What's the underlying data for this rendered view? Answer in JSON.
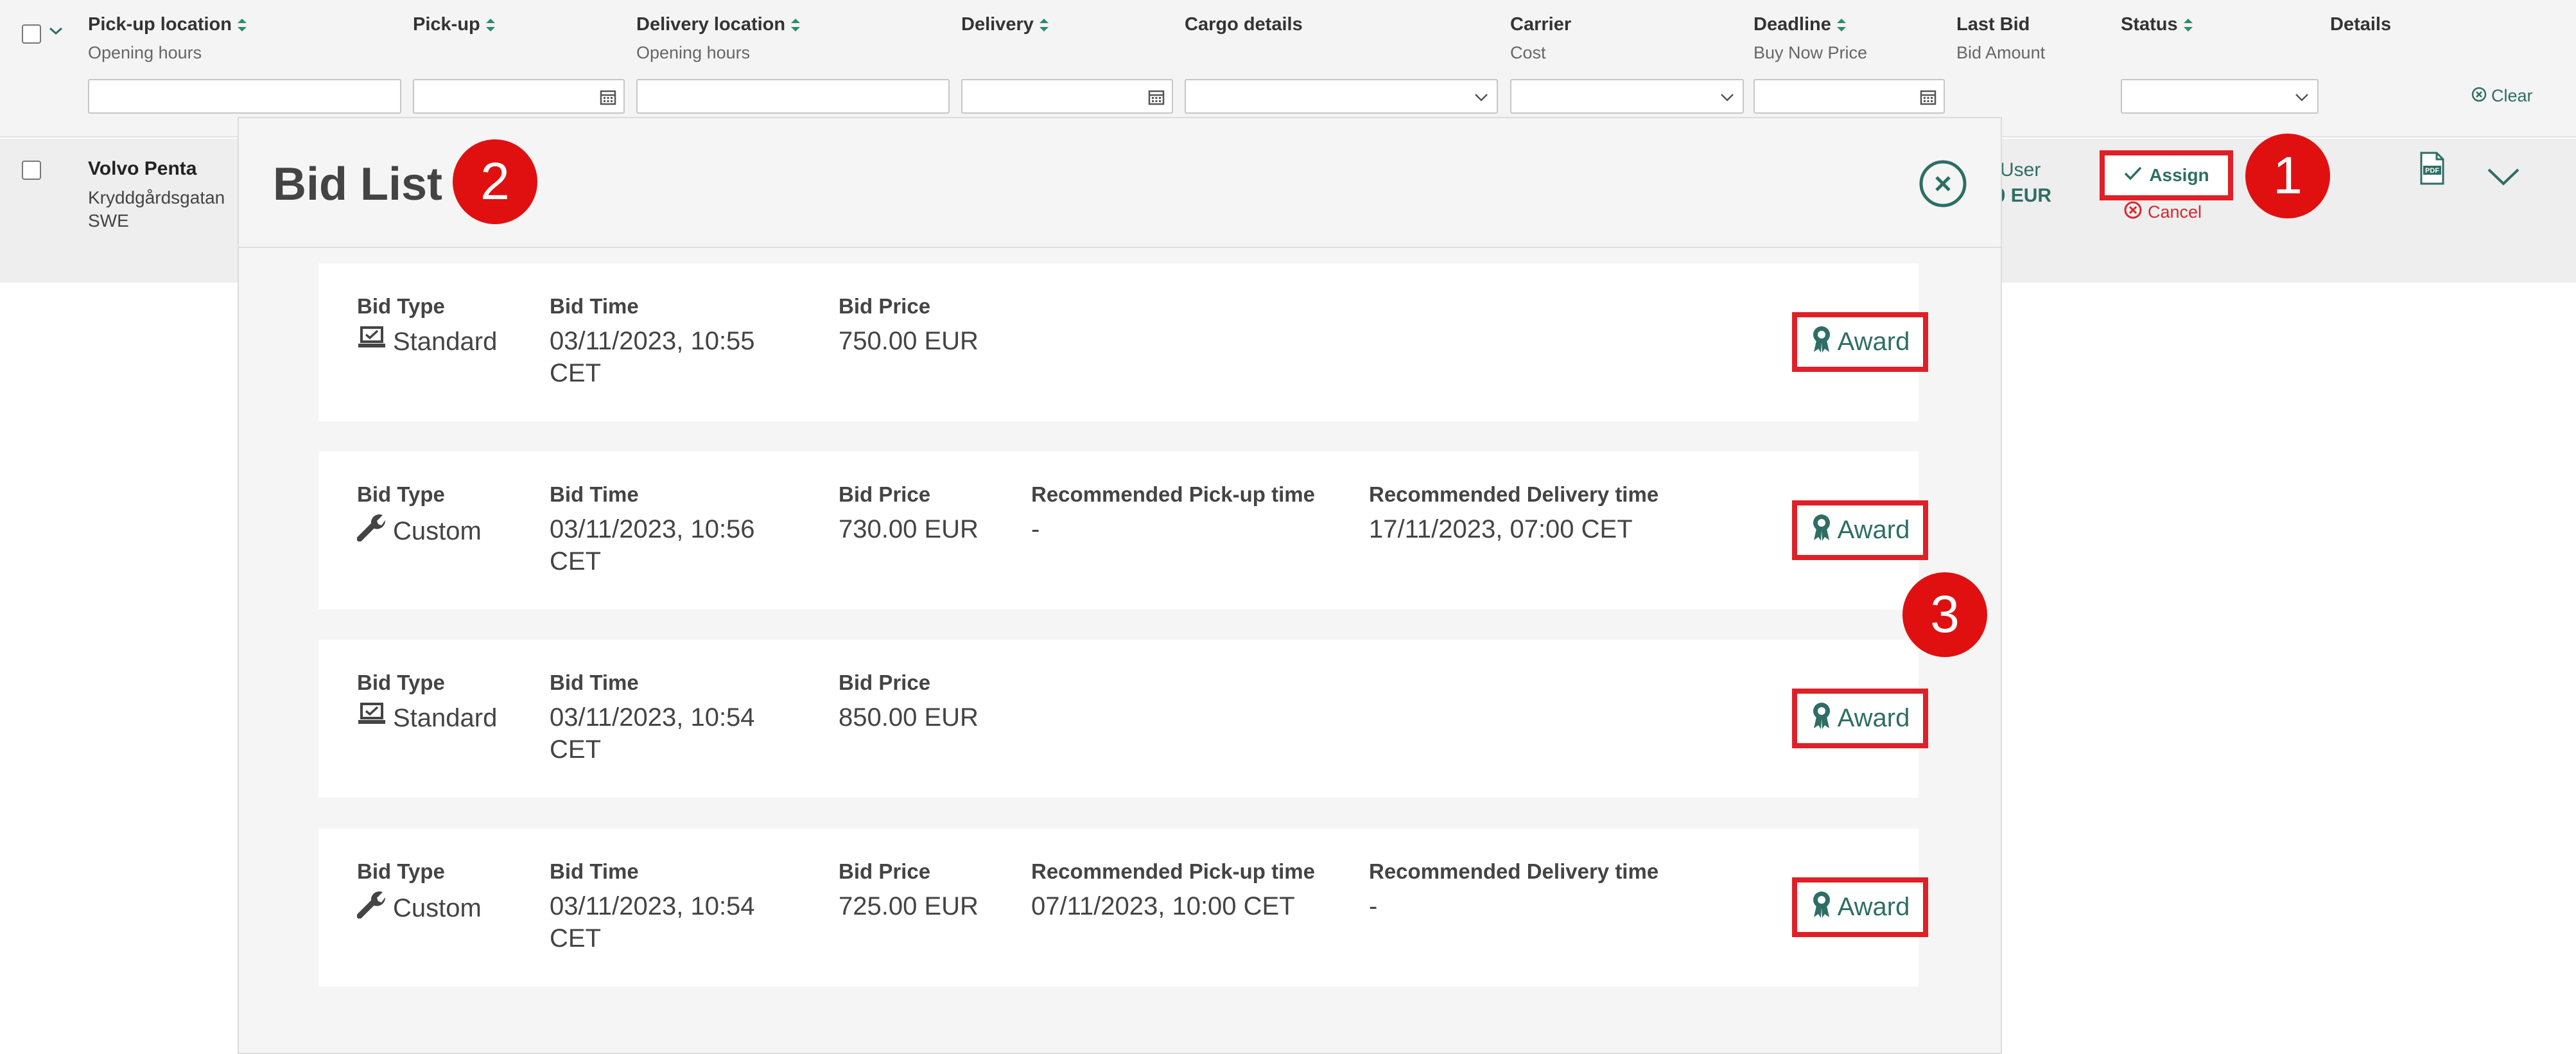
{
  "header": {
    "columns": [
      {
        "title": "Pick-up location",
        "sub": "Opening hours"
      },
      {
        "title": "Pick-up",
        "sub": ""
      },
      {
        "title": "Delivery location",
        "sub": "Opening hours"
      },
      {
        "title": "Delivery",
        "sub": ""
      },
      {
        "title": "Cargo details",
        "sub": ""
      },
      {
        "title": "Carrier",
        "sub": "Cost"
      },
      {
        "title": "Deadline",
        "sub": "Buy Now Price"
      },
      {
        "title": "Last Bid",
        "sub": "Bid Amount"
      },
      {
        "title": "Status",
        "sub": ""
      },
      {
        "title": "Details",
        "sub": ""
      }
    ],
    "clear_label": "Clear"
  },
  "row": {
    "company": "Volvo Penta",
    "street": "Kryddgårdsgatan",
    "country": "SWE",
    "carrier_partial": "o User",
    "amount_partial": "00 EUR",
    "assign_label": "Assign",
    "cancel_label": "Cancel"
  },
  "modal": {
    "title": "Bid List",
    "labels": {
      "bid_type": "Bid Type",
      "bid_time": "Bid Time",
      "bid_price": "Bid Price",
      "rec_pickup": "Recommended Pick-up time",
      "rec_delivery": "Recommended Delivery time",
      "award": "Award"
    },
    "bids": [
      {
        "type": "Standard",
        "icon": "laptop-icon",
        "time": "03/11/2023, 10:55 CET",
        "price": "750.00 EUR"
      },
      {
        "type": "Custom",
        "icon": "wrench-icon",
        "time": "03/11/2023, 10:56 CET",
        "price": "730.00 EUR",
        "rec_pickup": "-",
        "rec_delivery": "17/11/2023, 07:00 CET"
      },
      {
        "type": "Standard",
        "icon": "laptop-icon",
        "time": "03/11/2023, 10:54 CET",
        "price": "850.00 EUR"
      },
      {
        "type": "Custom",
        "icon": "wrench-icon",
        "time": "03/11/2023, 10:54 CET",
        "price": "725.00 EUR",
        "rec_pickup": "07/11/2023, 10:00 CET",
        "rec_delivery": "-"
      }
    ]
  },
  "badges": [
    "1",
    "2",
    "3"
  ],
  "colors": {
    "accent": "#2e6e64",
    "highlight": "#e01f26",
    "badge": "#e01010",
    "cancel": "#d7282f"
  }
}
